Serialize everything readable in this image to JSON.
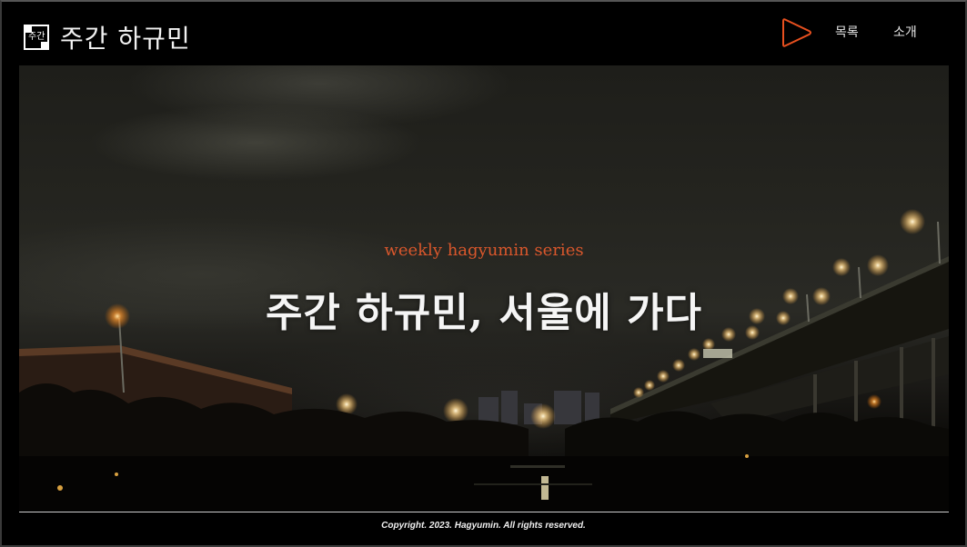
{
  "header": {
    "logo_mark_text": "주간",
    "site_title": "주간 하규민",
    "nav": [
      {
        "label": "목록"
      },
      {
        "label": "소개"
      }
    ],
    "play_icon": "play-icon",
    "accent_color": "#e8501f"
  },
  "hero": {
    "subtitle": "weekly hagyumin series",
    "title": "주간 하규민, 서울에 가다",
    "image_description_icon": "night-river-photo"
  },
  "footer": {
    "copyright": "Copyright. 2023. Hagyumin. All rights reserved."
  }
}
